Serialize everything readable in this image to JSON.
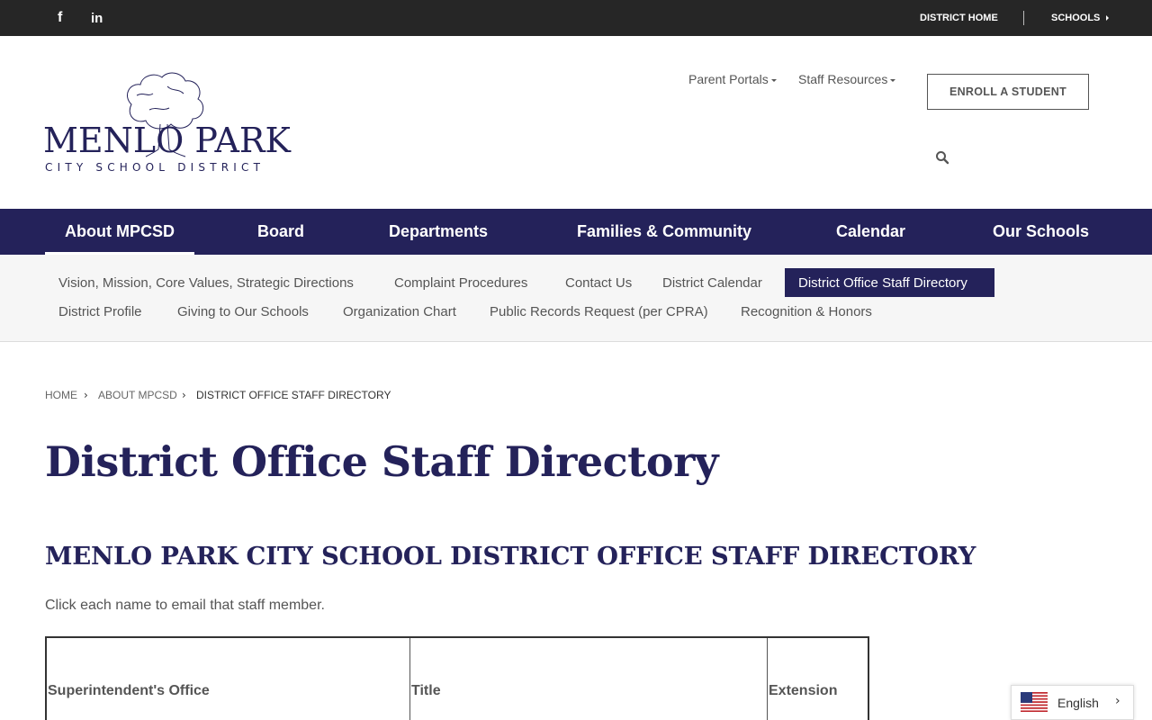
{
  "topbar": {
    "social": [
      {
        "icon": "facebook-icon",
        "glyph": "f"
      },
      {
        "icon": "linkedin-icon",
        "glyph": "in"
      }
    ],
    "district_home": "DISTRICT HOME",
    "schools": "SCHOOLS"
  },
  "logo": {
    "name": "MENLO PARK",
    "subtitle": "CITY SCHOOL DISTRICT"
  },
  "header": {
    "parent_portals": "Parent Portals",
    "staff_resources": "Staff Resources",
    "enroll_button": "ENROLL A STUDENT",
    "search_icon": "search-icon"
  },
  "main_nav": {
    "items": [
      {
        "label": "About MPCSD",
        "active": true
      },
      {
        "label": "Board"
      },
      {
        "label": "Departments"
      },
      {
        "label": "Families & Community"
      },
      {
        "label": "Calendar"
      },
      {
        "label": "Our Schools"
      }
    ]
  },
  "sub_nav": {
    "items": [
      {
        "label": "Vision, Mission, Core Values, Strategic Directions"
      },
      {
        "label": "Complaint Procedures"
      },
      {
        "label": "Contact Us"
      },
      {
        "label": "District Calendar"
      },
      {
        "label": "District Office Staff Directory",
        "active": true
      },
      {
        "label": "District Profile"
      },
      {
        "label": "Giving to Our Schools"
      },
      {
        "label": "Organization Chart"
      },
      {
        "label": "Public Records Request (per CPRA)"
      },
      {
        "label": "Recognition & Honors"
      }
    ]
  },
  "breadcrumb": [
    "HOME",
    "ABOUT MPCSD",
    "DISTRICT OFFICE STAFF DIRECTORY"
  ],
  "page": {
    "title": "District Office Staff Directory",
    "section_title": "MENLO PARK CITY SCHOOL DISTRICT OFFICE STAFF DIRECTORY",
    "intro": "Click each name to email that staff member."
  },
  "table": {
    "headers": [
      "Superintendent's Office",
      "Title",
      "Extension"
    ]
  },
  "language": {
    "label": "English",
    "flag": "us-flag-icon"
  },
  "colors": {
    "brand_navy": "#24225a",
    "topbar": "#262626",
    "subnav_bg": "#f6f6f6"
  }
}
